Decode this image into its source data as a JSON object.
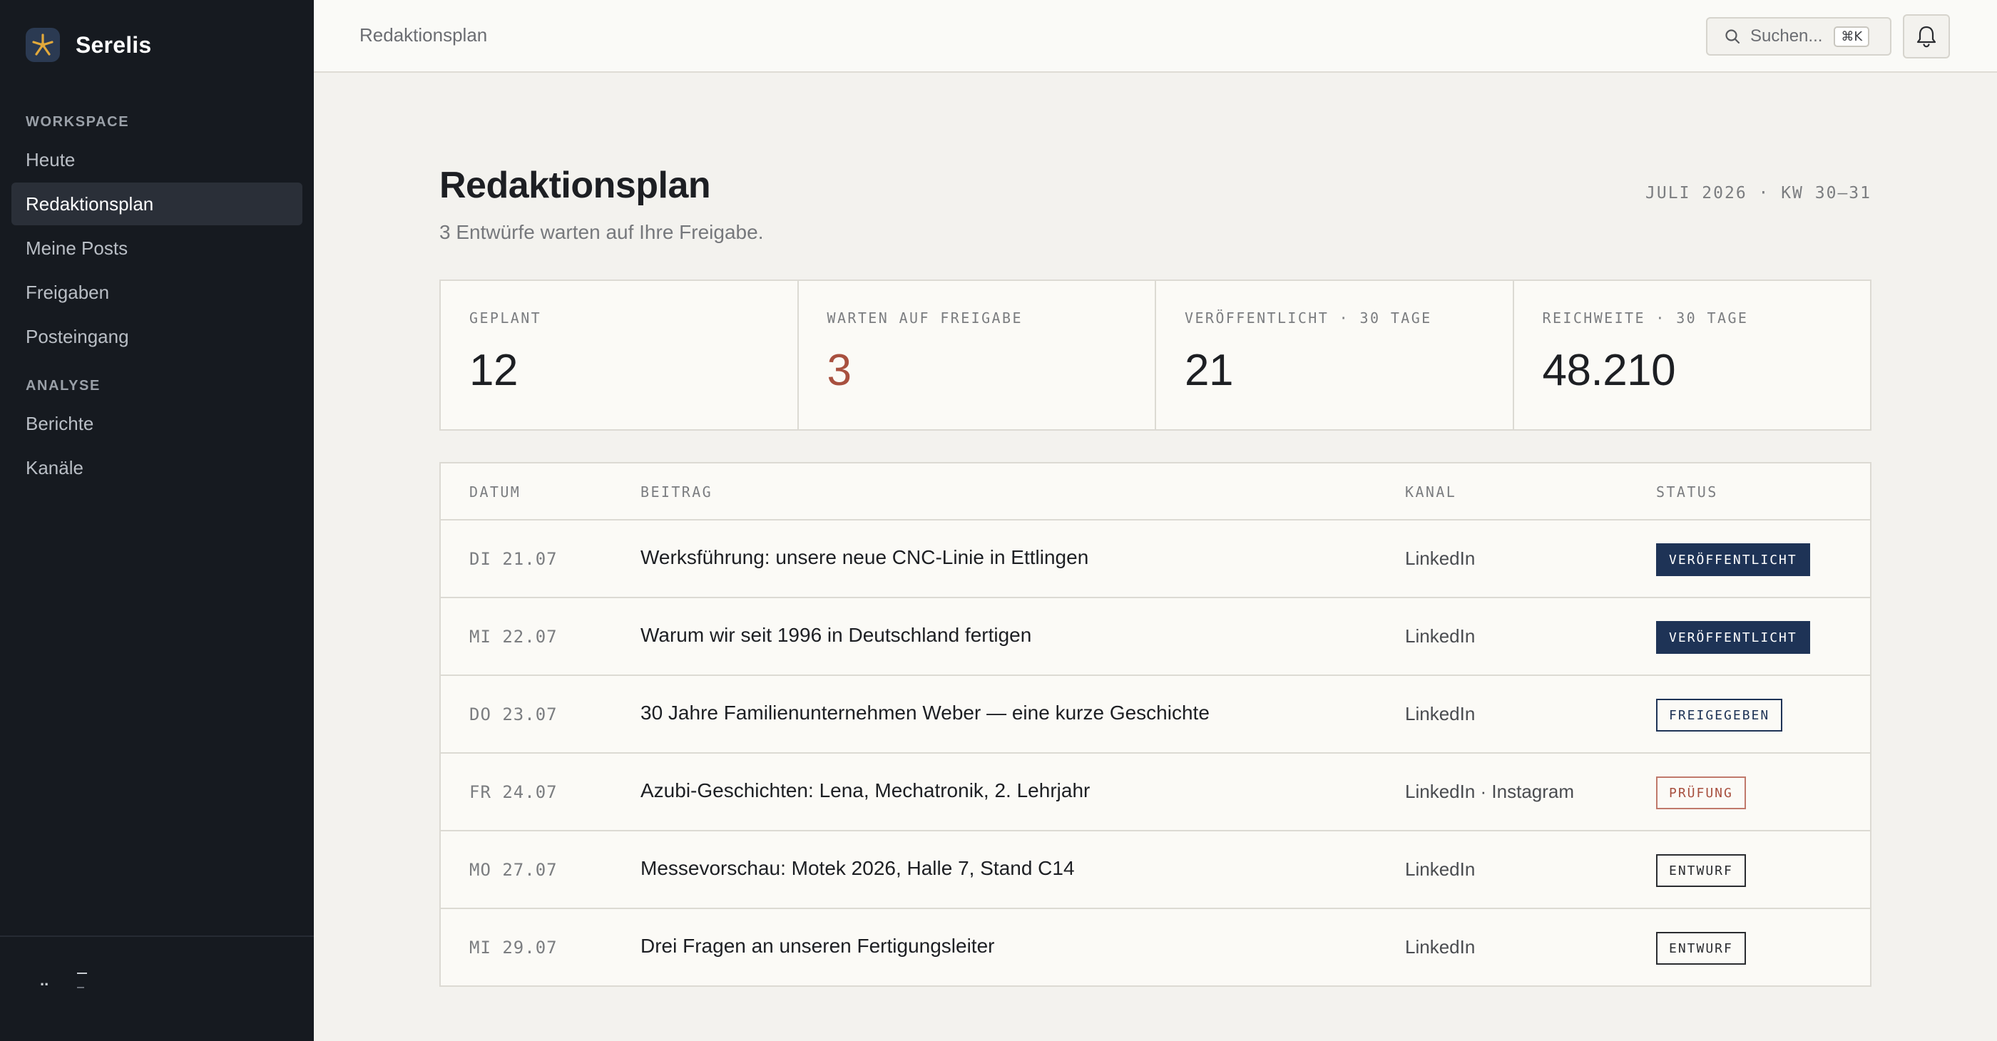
{
  "app": {
    "name": "Serelis"
  },
  "sidebar": {
    "sections": [
      {
        "label": "WORKSPACE",
        "items": [
          "Heute",
          "Redaktionsplan",
          "Meine Posts",
          "Freigaben",
          "Posteingang"
        ]
      },
      {
        "label": "ANALYSE",
        "items": [
          "Berichte",
          "Kanäle"
        ]
      }
    ],
    "active_item": "Redaktionsplan",
    "user": {
      "initials": "..",
      "name": "–",
      "role": "–"
    }
  },
  "topbar": {
    "breadcrumb": "Redaktionsplan",
    "search": {
      "placeholder": "Suchen...",
      "shortcut": "⌘K"
    },
    "icons": [
      "search-icon",
      "bell-icon"
    ]
  },
  "page": {
    "title": "Redaktionsplan",
    "subtitle": "3 Entwürfe warten auf Ihre Freigabe.",
    "period": "JULI 2026 · KW 30–31"
  },
  "stats": [
    {
      "label": "GEPLANT",
      "value": "12"
    },
    {
      "label": "WARTEN AUF FREIGABE",
      "value": "3",
      "highlight": "#a8503f"
    },
    {
      "label": "VERÖFFENTLICHT · 30 TAGE",
      "value": "21"
    },
    {
      "label": "REICHWEITE · 30 TAGE",
      "value": "48.210"
    }
  ],
  "table": {
    "columns": [
      "DATUM",
      "BEITRAG",
      "KANAL",
      "STATUS"
    ],
    "rows": [
      {
        "date": "DI 21.07",
        "title": "Werksführung: unsere neue CNC-Linie in Ettlingen",
        "channel": "LinkedIn",
        "status": "VERÖFFENTLICHT"
      },
      {
        "date": "MI 22.07",
        "title": "Warum wir seit 1996 in Deutschland fertigen",
        "channel": "LinkedIn",
        "status": "VERÖFFENTLICHT"
      },
      {
        "date": "DO 23.07",
        "title": "30 Jahre Familienunternehmen Weber — eine kurze Geschichte",
        "channel": "LinkedIn",
        "status": "FREIGEGEBEN"
      },
      {
        "date": "FR 24.07",
        "title": "Azubi-Geschichten: Lena, Mechatronik, 2. Lehrjahr",
        "channel": "LinkedIn · Instagram",
        "status": "PRÜFUNG"
      },
      {
        "date": "MO 27.07",
        "title": "Messevorschau: Motek 2026, Halle 7, Stand C14",
        "channel": "LinkedIn",
        "status": "ENTWURF"
      },
      {
        "date": "MI 29.07",
        "title": "Drei Fragen an unseren Fertigungsleiter",
        "channel": "LinkedIn",
        "status": "ENTWURF"
      }
    ]
  },
  "colors": {
    "sidebar_bg": "#161a20",
    "accent_navy": "#1e3356",
    "accent_rust": "#a8503f",
    "logo_yellow": "#e2a93b"
  }
}
